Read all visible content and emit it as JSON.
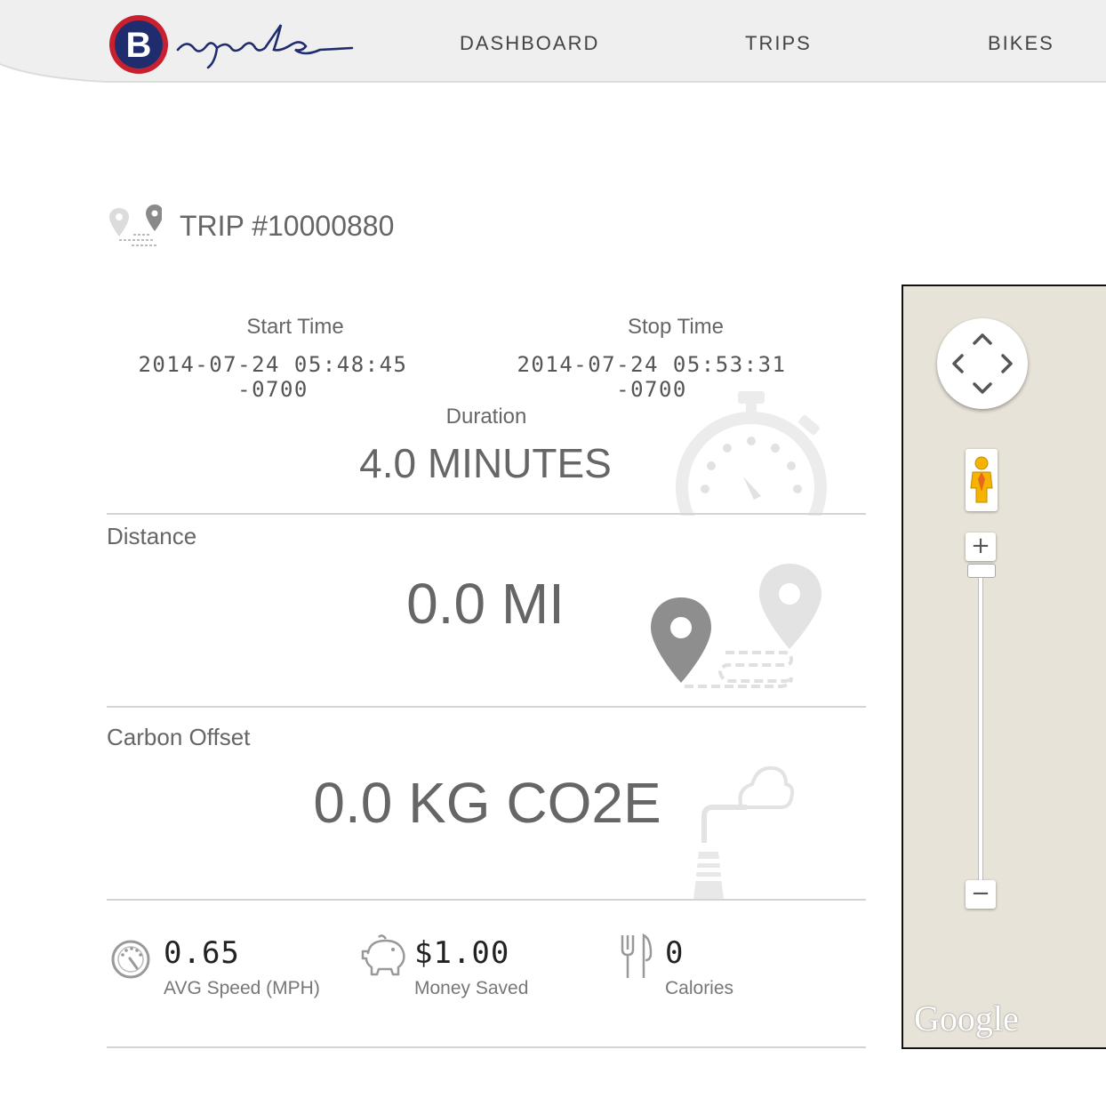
{
  "nav": {
    "items": [
      "DASHBOARD",
      "TRIPS",
      "BIKES"
    ]
  },
  "trip": {
    "title": "TRIP #10000880",
    "start_label": "Start Time",
    "start_value": "2014-07-24 05:48:45 -0700",
    "stop_label": "Stop Time",
    "stop_value": "2014-07-24 05:53:31 -0700",
    "duration_label": "Duration",
    "duration_value": "4.0 MINUTES",
    "distance_label": "Distance",
    "distance_value": "0.0 MI",
    "carbon_label": "Carbon Offset",
    "carbon_value": "0.0 KG CO2E"
  },
  "stats": [
    {
      "value": "0.65",
      "label": "AVG Speed (MPH)",
      "icon": "speedometer-icon"
    },
    {
      "value": "$1.00",
      "label": "Money Saved",
      "icon": "piggy-bank-icon"
    },
    {
      "value": "0",
      "label": "Calories",
      "icon": "fork-knife-icon"
    }
  ],
  "map": {
    "zoom_in": "+",
    "zoom_out": "−",
    "attribution": "Google",
    "background": "#e8e3d9"
  },
  "colors": {
    "brand_red": "#c8202f",
    "brand_navy": "#1f2d6e"
  }
}
